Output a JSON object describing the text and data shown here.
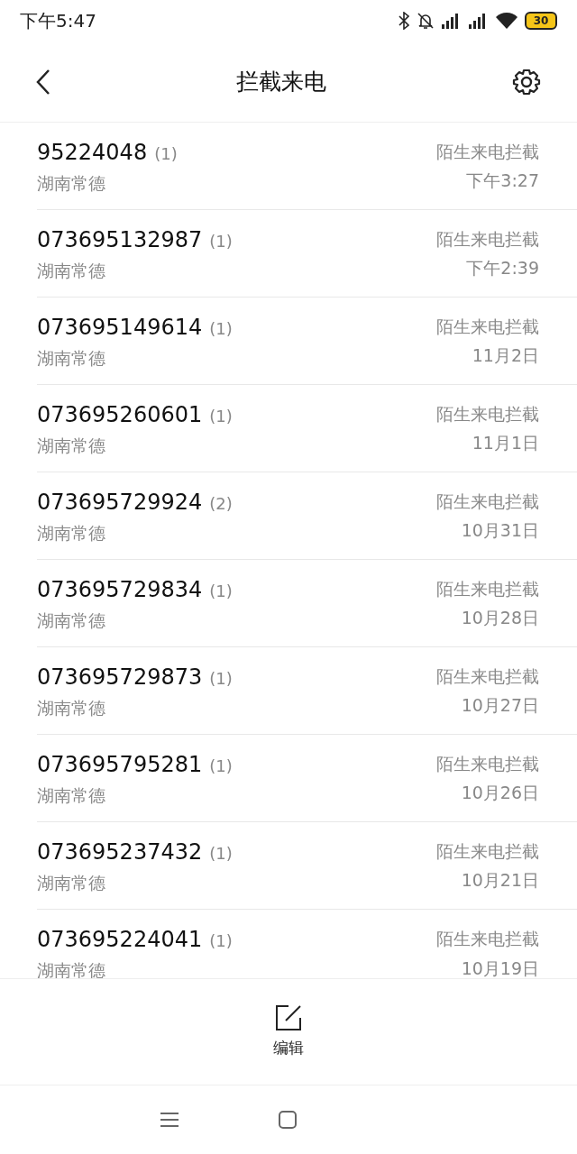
{
  "status_bar": {
    "time": "下午5:47",
    "battery": "30"
  },
  "header": {
    "title": "拦截来电"
  },
  "calls": [
    {
      "number": "95224048",
      "count": "(1)",
      "location": "湖南常德",
      "type": "陌生来电拦截",
      "time": "下午3:27"
    },
    {
      "number": "073695132987",
      "count": "(1)",
      "location": "湖南常德",
      "type": "陌生来电拦截",
      "time": "下午2:39"
    },
    {
      "number": "073695149614",
      "count": "(1)",
      "location": "湖南常德",
      "type": "陌生来电拦截",
      "time": "11月2日"
    },
    {
      "number": "073695260601",
      "count": "(1)",
      "location": "湖南常德",
      "type": "陌生来电拦截",
      "time": "11月1日"
    },
    {
      "number": "073695729924",
      "count": "(2)",
      "location": "湖南常德",
      "type": "陌生来电拦截",
      "time": "10月31日"
    },
    {
      "number": "073695729834",
      "count": "(1)",
      "location": "湖南常德",
      "type": "陌生来电拦截",
      "time": "10月28日"
    },
    {
      "number": "073695729873",
      "count": "(1)",
      "location": "湖南常德",
      "type": "陌生来电拦截",
      "time": "10月27日"
    },
    {
      "number": "073695795281",
      "count": "(1)",
      "location": "湖南常德",
      "type": "陌生来电拦截",
      "time": "10月26日"
    },
    {
      "number": "073695237432",
      "count": "(1)",
      "location": "湖南常德",
      "type": "陌生来电拦截",
      "time": "10月21日"
    },
    {
      "number": "073695224041",
      "count": "(1)",
      "location": "湖南常德",
      "type": "陌生来电拦截",
      "time": "10月19日"
    }
  ],
  "bottom_bar": {
    "edit_label": "编辑"
  }
}
